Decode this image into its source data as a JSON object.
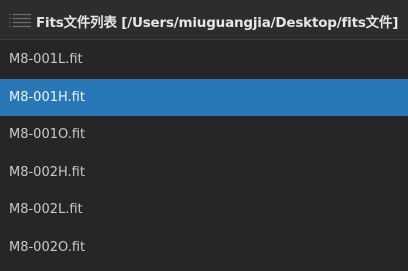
{
  "header": {
    "icon": "hamburger-menu-icon",
    "title": "Fits文件列表 [/Users/miuguangjia/Desktop/fits文件]"
  },
  "files": [
    {
      "name": "M8-001L.fit",
      "selected": false
    },
    {
      "name": "M8-001H.fit",
      "selected": true
    },
    {
      "name": "M8-001O.fit",
      "selected": false
    },
    {
      "name": "M8-002H.fit",
      "selected": false
    },
    {
      "name": "M8-002L.fit",
      "selected": false
    },
    {
      "name": "M8-002O.fit",
      "selected": false
    }
  ],
  "colors": {
    "background": "#262626",
    "selected": "#2878b8",
    "text": "#c9c9c9"
  }
}
